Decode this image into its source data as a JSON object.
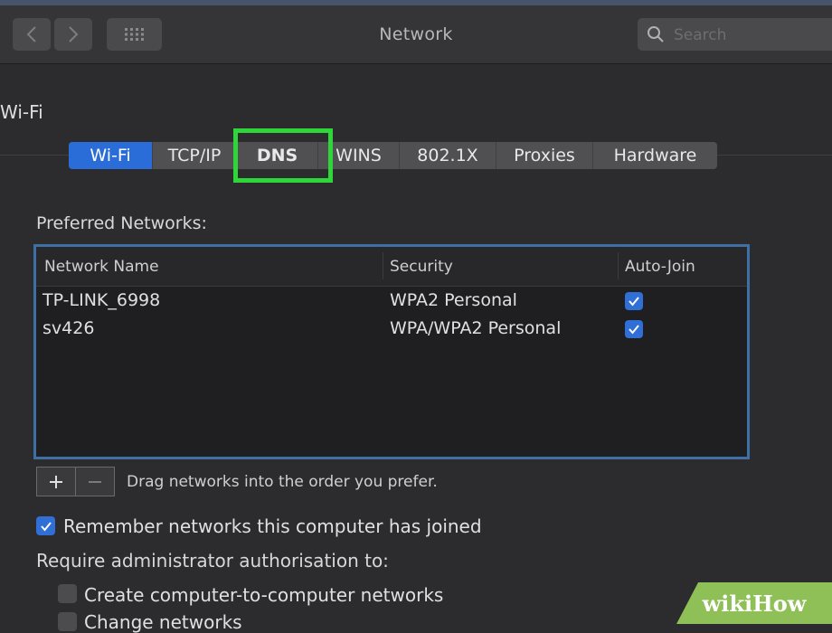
{
  "window": {
    "title": "Network",
    "search_placeholder": "Search"
  },
  "section": {
    "label": "Wi-Fi"
  },
  "tabs": [
    {
      "label": "Wi-Fi",
      "active": true
    },
    {
      "label": "TCP/IP",
      "active": false
    },
    {
      "label": "DNS",
      "active": false
    },
    {
      "label": "WINS",
      "active": false
    },
    {
      "label": "802.1X",
      "active": false
    },
    {
      "label": "Proxies",
      "active": false
    },
    {
      "label": "Hardware",
      "active": false
    }
  ],
  "preferred_networks": {
    "label": "Preferred Networks:",
    "columns": [
      "Network Name",
      "Security",
      "Auto-Join"
    ],
    "rows": [
      {
        "name": "TP-LINK_6998",
        "security": "WPA2 Personal",
        "auto_join": true
      },
      {
        "name": "sv426",
        "security": "WPA/WPA2 Personal",
        "auto_join": true
      }
    ]
  },
  "list_controls": {
    "add_label": "+",
    "remove_label": "−",
    "drag_note": "Drag networks into the order you prefer."
  },
  "options": {
    "remember_networks": {
      "label": "Remember networks this computer has joined",
      "checked": true
    },
    "require_admin_label": "Require administrator authorisation to:",
    "create_networks": {
      "label": "Create computer-to-computer networks",
      "checked": false
    },
    "change_networks": {
      "label": "Change networks",
      "checked": false
    }
  },
  "watermark": {
    "text": "wikiHow"
  },
  "colors": {
    "accent": "#2a6cd8",
    "highlight": "#2fd63a",
    "watermark": "#8fbf57"
  }
}
